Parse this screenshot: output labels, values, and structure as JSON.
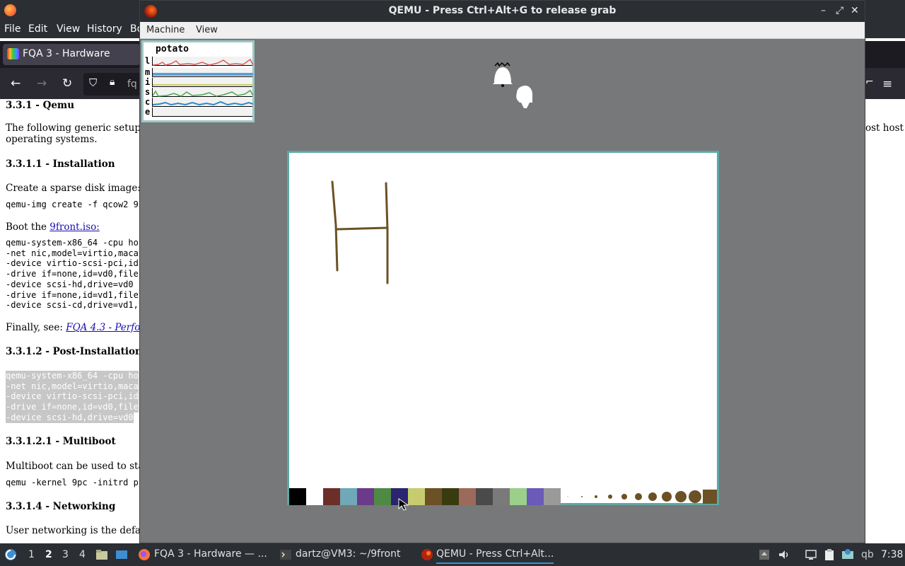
{
  "firefox": {
    "menu": [
      "File",
      "Edit",
      "View",
      "History",
      "Bo"
    ],
    "tab_title": "FQA 3 - Hardware",
    "url": "fq",
    "host_fragment": "st host",
    "content": {
      "h1": "3.3.1 - Qemu",
      "intro_line1": "The following generic setup",
      "intro_line2": "operating systems.",
      "intro_right": "ost host",
      "h_install": "3.3.1.1 - Installation",
      "p_sparse": "Create a sparse disk image:",
      "code_create": "qemu-img create -f qcow2 9",
      "p_boot_prefix": "Boot the ",
      "link_iso": "9front.iso:",
      "code_boot": "qemu-system-x86_64 -cpu ho\n-net nic,model=virtio,maca\n-device virtio-scsi-pci,id\n-drive if=none,id=vd0,file\n-device scsi-hd,drive=vd0\n-drive if=none,id=vd1,file\n-device scsi-cd,drive=vd1,",
      "p_finally_prefix": "Finally, see: ",
      "link_perf": "FQA 4.3 - Perfo",
      "h_post": "3.3.1.2 - Post-Installation",
      "code_post": [
        "qemu-system-x86_64 -cpu ho",
        "-net nic,model=virtio,maca",
        "-device virtio-scsi-pci,id",
        "-drive if=none,id=vd0,file",
        "-device scsi-hd,drive=vd0"
      ],
      "h_multiboot": "3.3.1.2.1 - Multiboot",
      "p_multiboot": "Multiboot can be used to sta",
      "code_multiboot": "qemu -kernel 9pc -initrd p",
      "h_network": "3.3.1.4 - Networking",
      "p_network": "User networking is the defa"
    }
  },
  "qemu": {
    "title": "QEMU - Press Ctrl+Alt+G to release grab",
    "window_buttons": [
      "–",
      "⤢",
      "✕"
    ],
    "menu": [
      "Machine",
      "View"
    ],
    "stats": {
      "title": "potato",
      "rows": [
        {
          "label": "l",
          "color": "#e05a5a"
        },
        {
          "label": "m",
          "color": "#5aa0d8"
        },
        {
          "label": "i",
          "color": "#cccc66"
        },
        {
          "label": "s",
          "color": "#4aa64a"
        },
        {
          "label": "c",
          "color": "#2d8ac7"
        },
        {
          "label": "e",
          "color": "#b0b0b0"
        }
      ]
    },
    "paint": {
      "stroke_color": "#6b5125",
      "palette": [
        "#000000",
        "#ffffff",
        "#6b2e28",
        "#6fa8b8",
        "#6b3a8a",
        "#4f8a45",
        "#2a256e",
        "#c8cc70",
        "#6b5125",
        "#3a3a10",
        "#9c6a5a",
        "#4a4a4a",
        "#7a7a7a",
        "#9ad08a",
        "#6b5ab8",
        "#9a9a9a"
      ],
      "brush_color": "#6b5125"
    }
  },
  "taskbar": {
    "workspaces": [
      "1",
      "2",
      "3",
      "4"
    ],
    "apps": [
      {
        "label": "FQA 3 - Hardware — ..."
      },
      {
        "label": "dartz@VM3: ~/9front"
      },
      {
        "label": "QEMU - Press Ctrl+Alt..."
      }
    ],
    "keyboard": "qb",
    "clock": "7:38"
  }
}
